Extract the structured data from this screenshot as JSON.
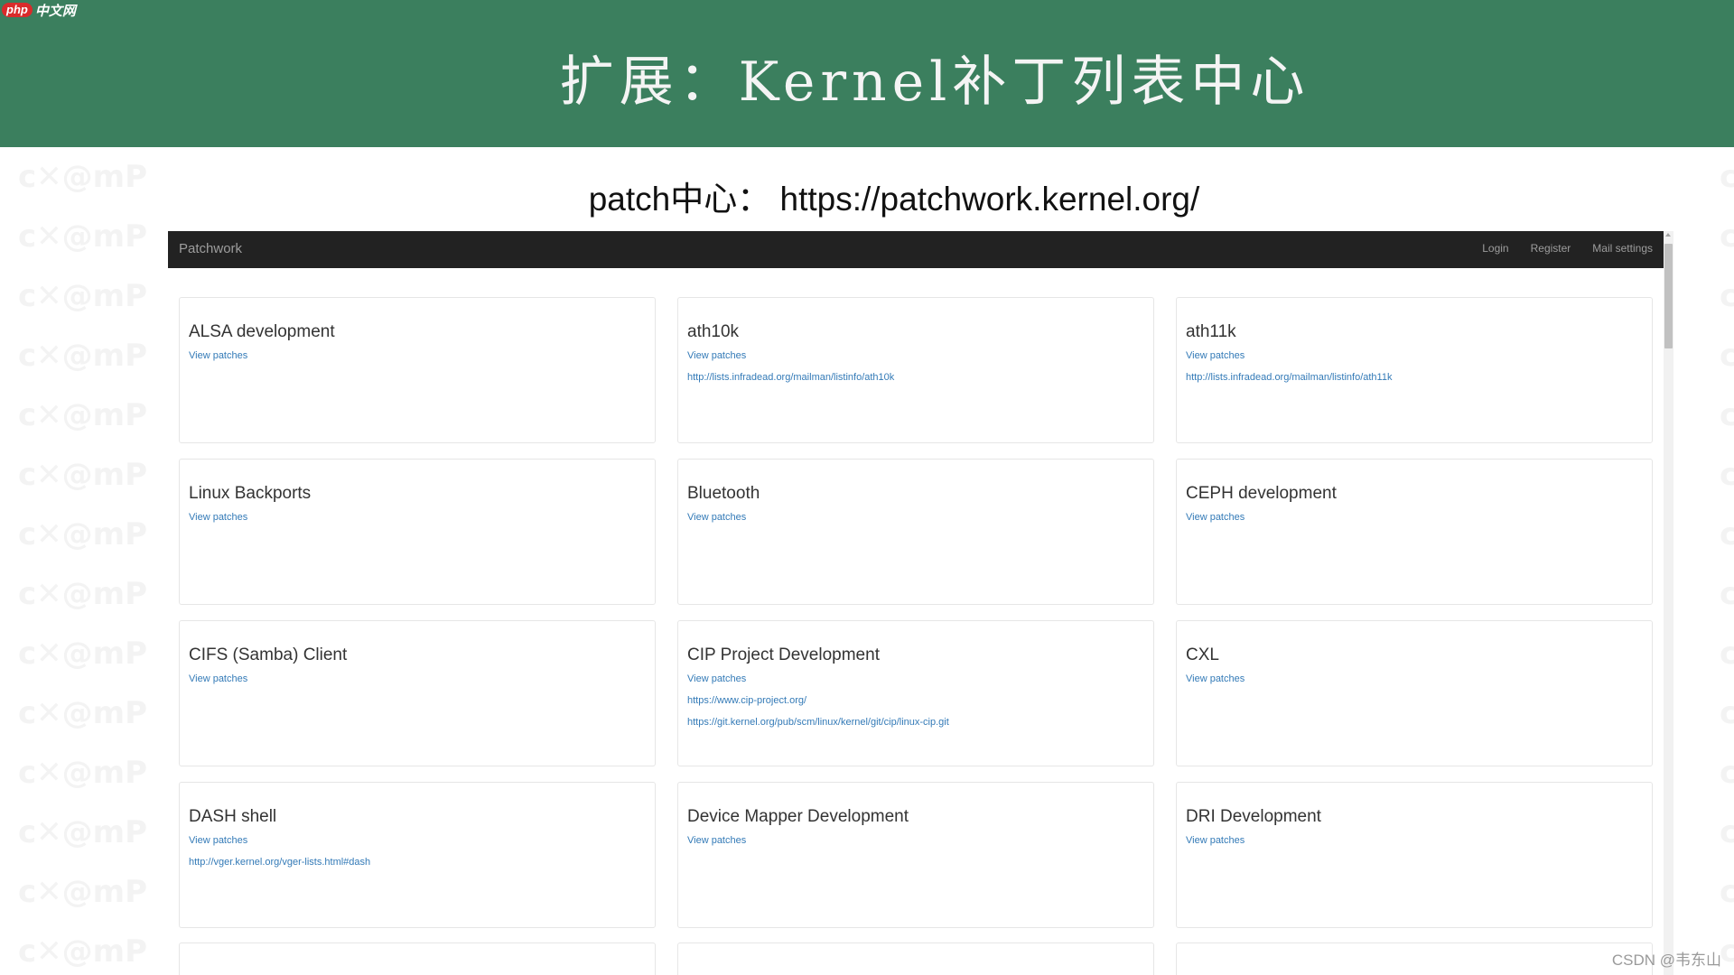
{
  "page": {
    "site_logo": "php",
    "site_logo_suffix": "中文网",
    "slide_title": "扩展：Kernel补丁列表中心",
    "subtitle": "patch中心：  https://patchwork.kernel.org/",
    "watermark_credit": "CSDN @韦东山",
    "accent_color": "#3b7f5e"
  },
  "navbar": {
    "brand": "Patchwork",
    "links": [
      "Login",
      "Register",
      "Mail settings"
    ]
  },
  "projects": [
    {
      "name": "ALSA development",
      "view": "View patches",
      "links": []
    },
    {
      "name": "ath10k",
      "view": "View patches",
      "links": [
        "http://lists.infradead.org/mailman/listinfo/ath10k"
      ]
    },
    {
      "name": "ath11k",
      "view": "View patches",
      "links": [
        "http://lists.infradead.org/mailman/listinfo/ath11k"
      ]
    },
    {
      "name": "Linux Backports",
      "view": "View patches",
      "links": []
    },
    {
      "name": "Bluetooth",
      "view": "View patches",
      "links": []
    },
    {
      "name": "CEPH development",
      "view": "View patches",
      "links": []
    },
    {
      "name": "CIFS (Samba) Client",
      "view": "View patches",
      "links": []
    },
    {
      "name": "CIP Project Development",
      "view": "View patches",
      "links": [
        "https://www.cip-project.org/",
        "https://git.kernel.org/pub/scm/linux/kernel/git/cip/linux-cip.git"
      ]
    },
    {
      "name": "CXL",
      "view": "View patches",
      "links": []
    },
    {
      "name": "DASH shell",
      "view": "View patches",
      "links": [
        "http://vger.kernel.org/vger-lists.html#dash"
      ]
    },
    {
      "name": "Device Mapper Development",
      "view": "View patches",
      "links": []
    },
    {
      "name": "DRI Development",
      "view": "View patches",
      "links": []
    }
  ]
}
